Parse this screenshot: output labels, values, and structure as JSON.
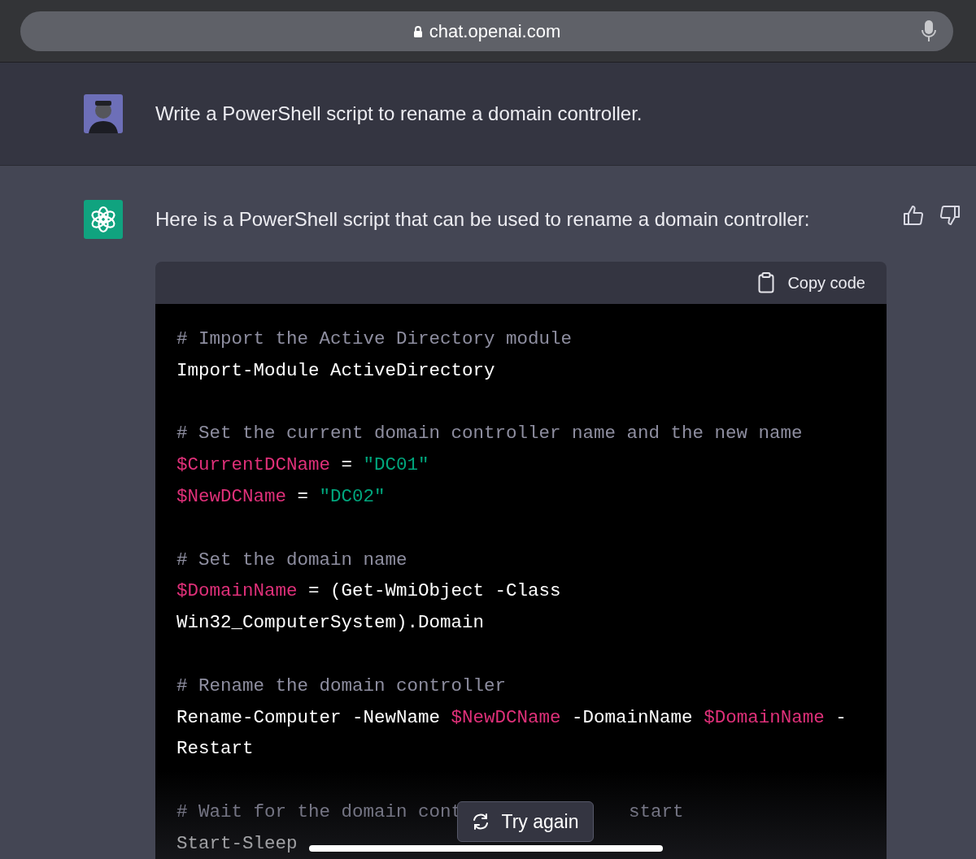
{
  "browser": {
    "url": "chat.openai.com"
  },
  "user_message": {
    "text": "Write a PowerShell script to rename a domain controller."
  },
  "assistant_message": {
    "text": "Here is a PowerShell script that can be used to rename a domain controller:",
    "code_block": {
      "copy_label": "Copy code",
      "lines": [
        {
          "kind": "code",
          "tokens": [
            {
              "kind": "comment",
              "text": "# Import the Active Directory module"
            }
          ]
        },
        {
          "kind": "code",
          "tokens": [
            {
              "kind": "plain",
              "text": "Import-Module ActiveDirectory"
            }
          ]
        },
        {
          "kind": "blank"
        },
        {
          "kind": "code",
          "tokens": [
            {
              "kind": "comment",
              "text": "# Set the current domain controller name and the new name"
            }
          ]
        },
        {
          "kind": "code",
          "tokens": [
            {
              "kind": "variable",
              "text": "$CurrentDCName"
            },
            {
              "kind": "plain",
              "text": " = "
            },
            {
              "kind": "string",
              "text": "\"DC01\""
            }
          ]
        },
        {
          "kind": "code",
          "tokens": [
            {
              "kind": "variable",
              "text": "$NewDCName"
            },
            {
              "kind": "plain",
              "text": " = "
            },
            {
              "kind": "string",
              "text": "\"DC02\""
            }
          ]
        },
        {
          "kind": "blank"
        },
        {
          "kind": "code",
          "tokens": [
            {
              "kind": "comment",
              "text": "# Set the domain name"
            }
          ]
        },
        {
          "kind": "code",
          "tokens": [
            {
              "kind": "variable",
              "text": "$DomainName"
            },
            {
              "kind": "plain",
              "text": " = (Get-WmiObject -Class"
            }
          ]
        },
        {
          "kind": "code",
          "tokens": [
            {
              "kind": "plain",
              "text": "Win32_ComputerSystem).Domain"
            }
          ]
        },
        {
          "kind": "blank"
        },
        {
          "kind": "code",
          "tokens": [
            {
              "kind": "comment",
              "text": "# Rename the domain controller"
            }
          ]
        },
        {
          "kind": "code",
          "tokens": [
            {
              "kind": "plain",
              "text": "Rename-Computer -NewName "
            },
            {
              "kind": "variable",
              "text": "$NewDCName"
            },
            {
              "kind": "plain",
              "text": " -DomainName "
            },
            {
              "kind": "variable",
              "text": "$DomainName"
            },
            {
              "kind": "plain",
              "text": " -"
            }
          ]
        },
        {
          "kind": "code",
          "tokens": [
            {
              "kind": "plain",
              "text": "Restart"
            }
          ]
        },
        {
          "kind": "blank"
        },
        {
          "kind": "interrupted",
          "tokens": [
            {
              "kind": "comment",
              "text": "# Wait for the domain cont"
            },
            {
              "kind": "comment",
              "text": "start"
            }
          ]
        },
        {
          "kind": "code",
          "tokens": [
            {
              "kind": "plain",
              "text": "Start-Sleep"
            }
          ]
        }
      ]
    }
  },
  "try_again_button": {
    "label": "Try again"
  }
}
